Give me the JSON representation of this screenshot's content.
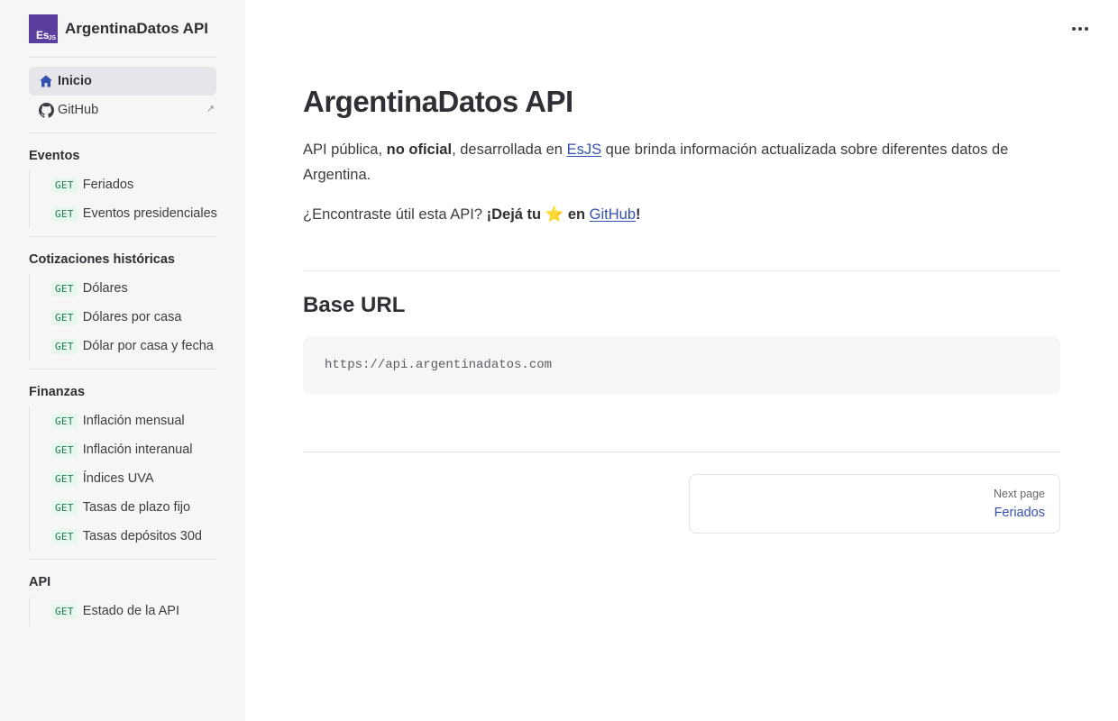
{
  "brand": {
    "logo_main": "Es",
    "logo_sub": "JS",
    "title": "ArgentinaDatos API",
    "logo_color": "#5a3f9f"
  },
  "top_nav": [
    {
      "label": "Inicio",
      "icon": "home-icon",
      "active": true
    },
    {
      "label": "GitHub",
      "icon": "github-icon",
      "external_marker": "↗"
    }
  ],
  "method_label": "GET",
  "groups": [
    {
      "title": "Eventos",
      "items": [
        "Feriados",
        "Eventos presidenciales"
      ]
    },
    {
      "title": "Cotizaciones históricas",
      "items": [
        "Dólares",
        "Dólares por casa",
        "Dólar por casa y fecha"
      ]
    },
    {
      "title": "Finanzas",
      "items": [
        "Inflación mensual",
        "Inflación interanual",
        "Índices UVA",
        "Tasas de plazo fijo",
        "Tasas depósitos 30d"
      ]
    },
    {
      "title": "API",
      "items": [
        "Estado de la API"
      ]
    }
  ],
  "main": {
    "title": "ArgentinaDatos API",
    "intro": {
      "t1": "API pública, ",
      "bold1": "no oficial",
      "t2": ", desarrollada en ",
      "link1": "EsJS",
      "t3": " que brinda información actualizada sobre diferentes datos de Argentina."
    },
    "cta": {
      "t1": "¿Encontraste útil esta API? ",
      "bold1": "¡Dejá tu ⭐ en ",
      "link1": "GitHub",
      "bold2": "!"
    },
    "base_url_heading": "Base URL",
    "base_url": "https://api.argentinadatos.com",
    "pager": {
      "label": "Next page",
      "title": "Feriados"
    }
  },
  "colors": {
    "accent": "#3451b2",
    "badge_text": "#18794e",
    "badge_bg": "#e8f7ee",
    "sidebar_bg": "#f6f6f7"
  }
}
